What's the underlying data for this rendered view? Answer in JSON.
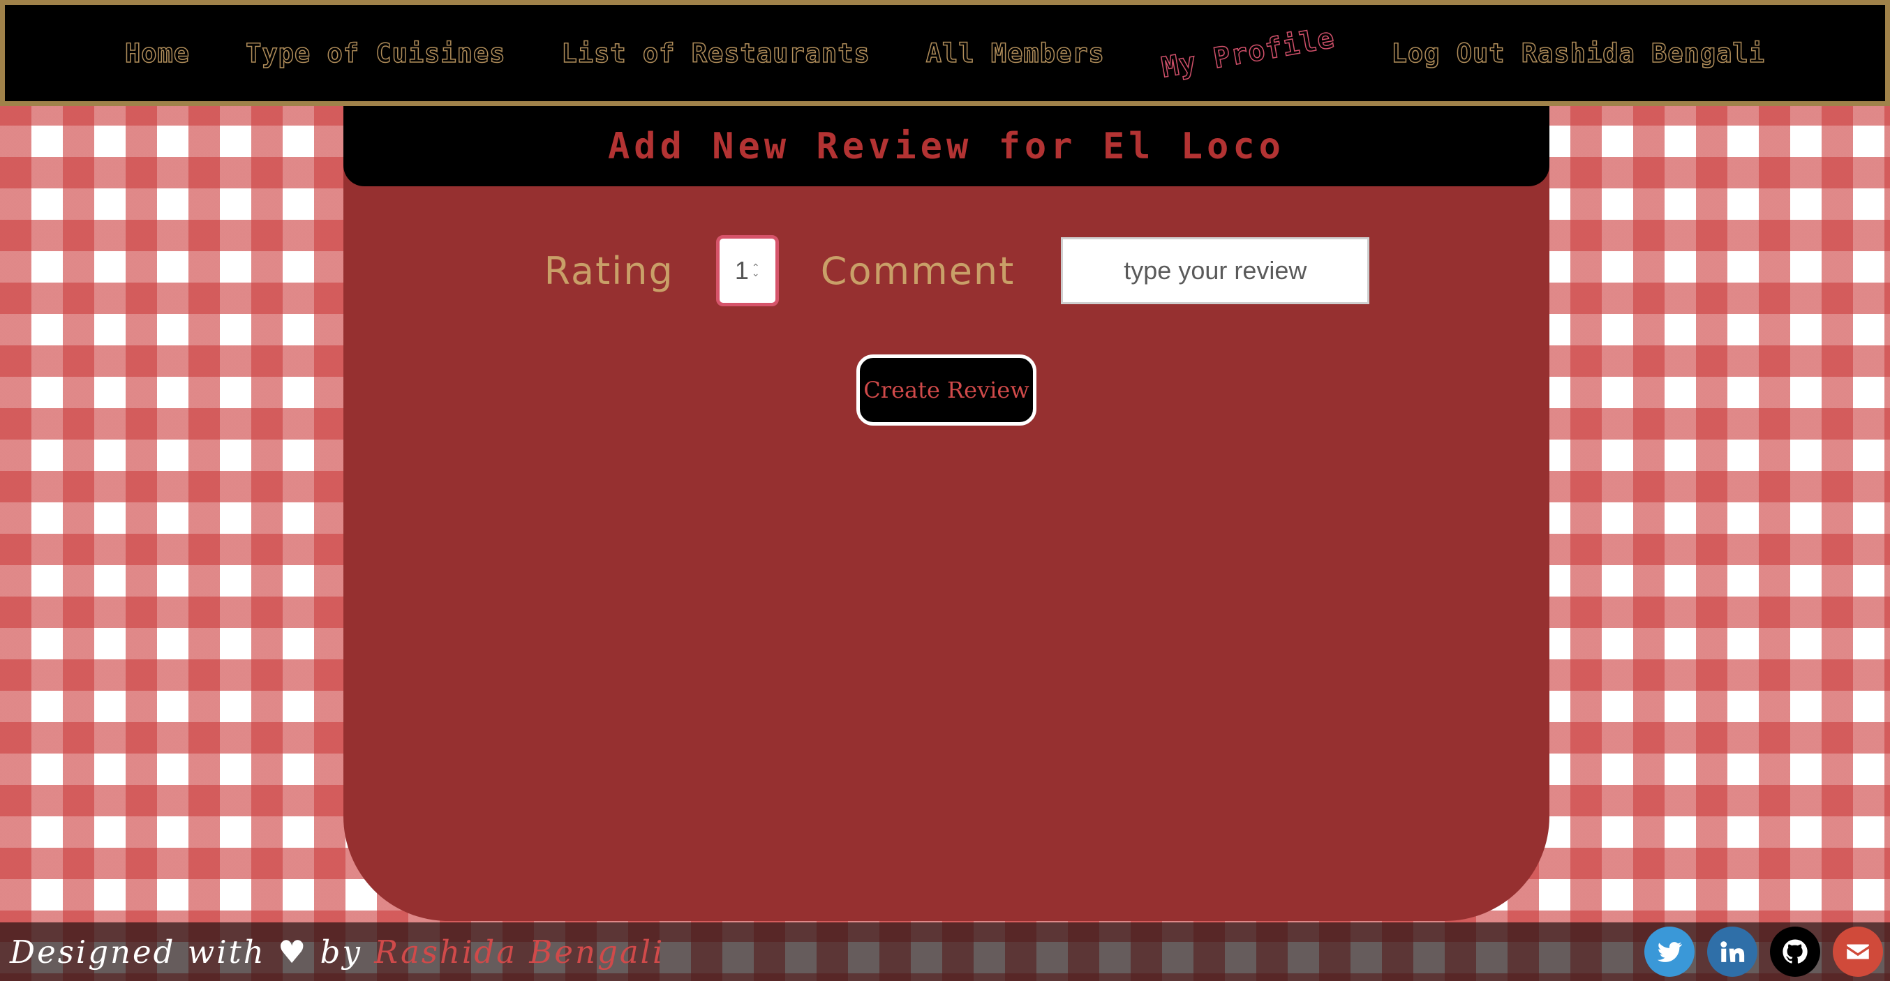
{
  "nav": {
    "items": [
      {
        "label": "Home"
      },
      {
        "label": "Type of Cuisines"
      },
      {
        "label": "List of Restaurants"
      },
      {
        "label": "All Members"
      },
      {
        "label": "My Profile"
      },
      {
        "label": "Log Out Rashida Bengali"
      }
    ]
  },
  "panel": {
    "title": "Add New Review for El Loco",
    "rating_label": "Rating",
    "rating_value": "1",
    "comment_label": "Comment",
    "comment_placeholder": "type your review",
    "submit_label": "Create Review"
  },
  "footer": {
    "text": "Designed with ♥ by ",
    "author": "Rashida Bengali",
    "social": [
      {
        "icon": "twitter-icon",
        "color": "#3a98d8"
      },
      {
        "icon": "linkedin-icon",
        "color": "#2f6fa8"
      },
      {
        "icon": "github-icon",
        "color": "#000000"
      },
      {
        "icon": "mail-icon",
        "color": "#d04a3a"
      }
    ]
  },
  "colors": {
    "nav_text": "#b08d5a",
    "nav_active": "#d0506a",
    "panel_bg": "#963030",
    "title": "#b33333",
    "labels": "#c9a068"
  }
}
